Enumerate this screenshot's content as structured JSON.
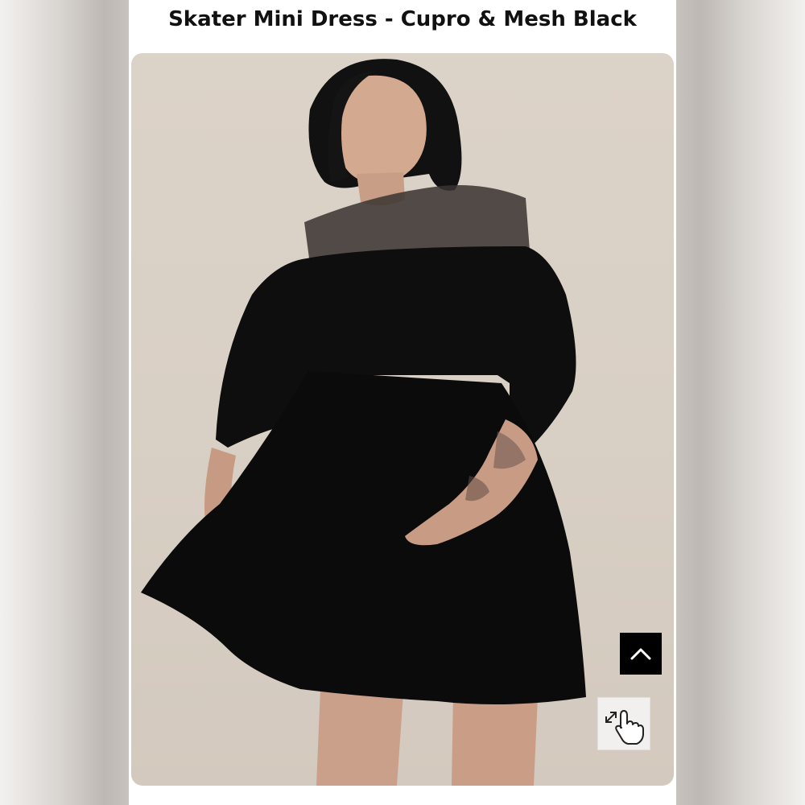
{
  "product": {
    "title": "Skater Mini Dress - Cupro & Mesh Black",
    "image_description_icon": "product-photo"
  },
  "controls": {
    "scroll_top_icon": "chevron-up-icon",
    "zoom_icon": "pinch-zoom-hand-icon"
  },
  "colors": {
    "background": "#ffffff",
    "photo_backdrop": "#d9d0c5",
    "dress": "#0d0d0d",
    "button": "#000000"
  }
}
